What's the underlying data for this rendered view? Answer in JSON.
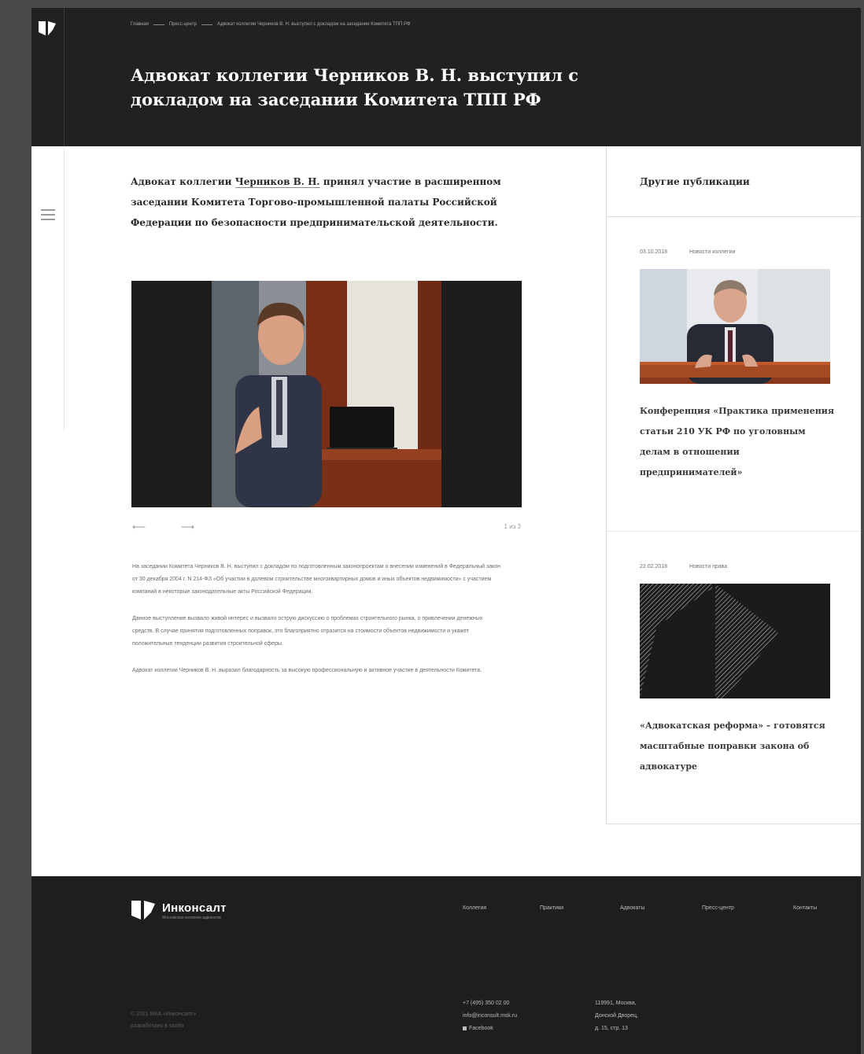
{
  "header": {
    "breadcrumb": [
      "Главная",
      "Пресс-центр",
      "Адвокат коллегии Черников В. Н. выступил с докладом на заседании Комитета ТПП РФ"
    ],
    "title": "Адвокат коллегии Черников В. Н. выступил с докладом на заседании Комитета ТПП РФ"
  },
  "article": {
    "lead_prefix": "Адвокат коллегии ",
    "lead_link": "Черников В. Н.",
    "lead_suffix": " принял участие в расширенном заседании Комитета Торгово-промышленной палаты Российской Федерации по безопасности предпринимательской деятельности.",
    "gallery": {
      "prev_arrow": "⟵",
      "next_arrow": "⟶",
      "counter": "1 из 3"
    },
    "paragraphs": [
      "На заседании Комитета Черников В. Н. выступил с докладом по подготовленным законопроектам о внесении изменений в Федеральный закон от 30 декабря 2004 г. N 214-ФЗ «Об участии в долевом строительстве многоквартирных домов и иных объектов недвижимости» с участием компаний в некоторые законодательные акты Российской Федерации.",
      "Данное выступление вызвало живой интерес и вызвало острую дискуссию о проблемах строительного рынка, о привлечении денежных средств. В случае принятия подготовленных поправок, это благоприятно отразится на стоимости объектов недвижимости и укажет положительные тенденции развития строительной сферы.",
      "Адвокат коллегии Черников В. Н. выразил благодарность за высокую профессиональную и активное участие в деятельности Комитета."
    ]
  },
  "sidebar": {
    "title": "Другие публикации",
    "cards": [
      {
        "date": "03.10.2018",
        "category": "Новости коллегии",
        "title": "Конференция «Практика применения статьи 210 УК РФ по уголовным делам в отношении предпринимателей»"
      },
      {
        "date": "22.02.2018",
        "category": "Новости права",
        "title": "«Адвокатская реформа» – готовятся масштабные поправки закона об адвокатуре"
      }
    ]
  },
  "footer": {
    "brand_name": "Инконсалт",
    "brand_sub": "Московская коллегия адвокатов",
    "nav": [
      "Коллегия",
      "Практики",
      "Адвокаты",
      "Пресс-центр",
      "Контакты"
    ],
    "copyright": "© 2021 МКА «Инконсалт»",
    "dev": "разработано в studio",
    "phone": "+7 (495) 350 02 00",
    "email": "info@inconsult.msk.ru",
    "facebook": "Facebook",
    "address": [
      "119991, Москва,",
      "Донской Дворец,",
      "д. 15, стр. 13"
    ]
  },
  "colors": {
    "dark": "#212121",
    "footer": "#1e1e1e",
    "background": "#4a4a4a",
    "page": "#ffffff"
  }
}
